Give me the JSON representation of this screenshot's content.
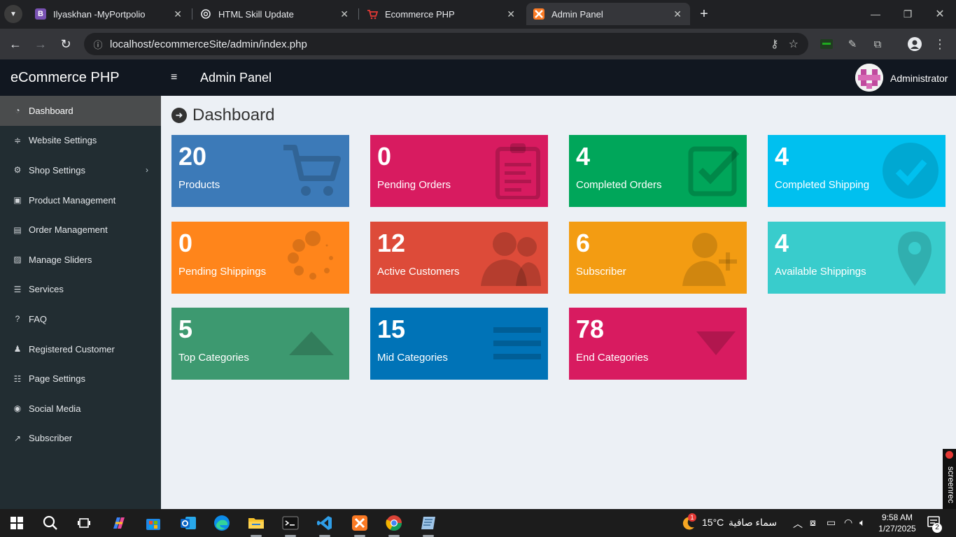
{
  "browser": {
    "tabs": [
      {
        "title": "Ilyaskhan -MyPortpolio",
        "favicon": "bootstrap-icon",
        "favicon_color": "#7952b3",
        "favicon_text": "B",
        "close": "✕"
      },
      {
        "title": "HTML Skill Update",
        "favicon": "chatgpt-icon",
        "favicon_color": "#202124",
        "favicon_text": "",
        "close": "✕"
      },
      {
        "title": "Ecommerce PHP",
        "favicon": "cart-icon",
        "favicon_color": "#202124",
        "favicon_text": "",
        "close": "✕"
      },
      {
        "title": "Admin Panel",
        "favicon": "xampp-icon",
        "favicon_color": "#fb7a24",
        "favicon_text": "",
        "close": "✕"
      }
    ],
    "url": "localhost/ecommerceSite/admin/index.php",
    "new_tab": "+"
  },
  "app": {
    "brand": "eCommerce PHP",
    "panel_title": "Admin Panel",
    "user": "Administrator",
    "hamburger": "≡",
    "page_title": "Dashboard"
  },
  "sidebar": {
    "items": [
      {
        "label": "Dashboard",
        "icon": "dashboard-icon",
        "glyph": "◔",
        "active": true
      },
      {
        "label": "Website Settings",
        "icon": "sliders-icon",
        "glyph": "≑"
      },
      {
        "label": "Shop Settings",
        "icon": "cogs-icon",
        "glyph": "⚙",
        "chevron": "›"
      },
      {
        "label": "Product Management",
        "icon": "shopping-bag-icon",
        "glyph": "▣"
      },
      {
        "label": "Order Management",
        "icon": "sticky-note-icon",
        "glyph": "▤"
      },
      {
        "label": "Manage Sliders",
        "icon": "picture-icon",
        "glyph": "▨"
      },
      {
        "label": "Services",
        "icon": "list-icon",
        "glyph": "☰"
      },
      {
        "label": "FAQ",
        "icon": "question-circle-icon",
        "glyph": "?"
      },
      {
        "label": "Registered Customer",
        "icon": "user-plus-icon",
        "glyph": "♟"
      },
      {
        "label": "Page Settings",
        "icon": "tasks-icon",
        "glyph": "☷"
      },
      {
        "label": "Social Media",
        "icon": "globe-icon",
        "glyph": "◉"
      },
      {
        "label": "Subscriber",
        "icon": "share-icon",
        "glyph": "↗"
      }
    ]
  },
  "boxes": [
    {
      "value": "20",
      "label": "Products",
      "color": "#3c7ab8",
      "icon": "cart-icon"
    },
    {
      "value": "0",
      "label": "Pending Orders",
      "color": "#d81b60",
      "icon": "clipboard-icon"
    },
    {
      "value": "4",
      "label": "Completed Orders",
      "color": "#00a65a",
      "icon": "check-square-icon"
    },
    {
      "value": "4",
      "label": "Completed Shipping",
      "color": "#00c0ef",
      "icon": "check-circle-icon"
    },
    {
      "value": "0",
      "label": "Pending Shippings",
      "color": "#ff851b",
      "icon": "spinner-icon"
    },
    {
      "value": "12",
      "label": "Active Customers",
      "color": "#dd4b39",
      "icon": "users-icon"
    },
    {
      "value": "6",
      "label": "Subscriber",
      "color": "#f39c12",
      "icon": "user-plus-icon"
    },
    {
      "value": "4",
      "label": "Available Shippings",
      "color": "#39cccc",
      "icon": "map-marker-icon"
    },
    {
      "value": "5",
      "label": "Top Categories",
      "color": "#3d9970",
      "icon": "caret-up-icon"
    },
    {
      "value": "15",
      "label": "Mid Categories",
      "color": "#0073b7",
      "icon": "bars-icon"
    },
    {
      "value": "78",
      "label": "End Categories",
      "color": "#d81b60",
      "icon": "caret-down-icon"
    }
  ],
  "taskbar": {
    "weather_temp": "15°C",
    "weather_text": "سماء صافية",
    "weather_badge": "1",
    "time": "9:58 AM",
    "date": "1/27/2025",
    "notifications": "2",
    "screenrec": "screenrec"
  }
}
